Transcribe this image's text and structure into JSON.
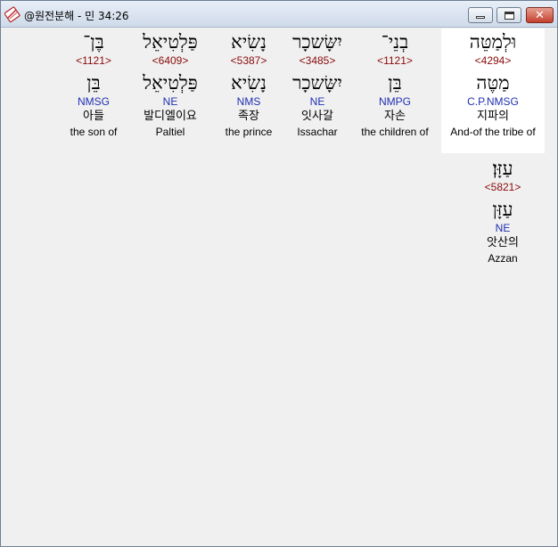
{
  "window": {
    "title": "@원전분해 - 민 34:26"
  },
  "words": [
    {
      "hebrew": "בֶּן־",
      "strong": "<1121>",
      "lemma": "בֵּן",
      "morph": "NMSG",
      "korean": "아들",
      "english": "the son of"
    },
    {
      "hebrew": "פַּלְטִיאֵל",
      "strong": "<6409>",
      "lemma": "פַּלְטִיאֵל",
      "morph": "NE",
      "korean": "발디엘이요",
      "english": "Paltiel"
    },
    {
      "hebrew": "נָשִׂיא",
      "strong": "<5387>",
      "lemma": "נָשִׂיא",
      "morph": "NMS",
      "korean": "족장",
      "english": "the prince"
    },
    {
      "hebrew": "יִשָּׂשכָר",
      "strong": "<3485>",
      "lemma": "יִשָּׂשכָר",
      "morph": "NE",
      "korean": "잇사갈",
      "english": "Issachar"
    },
    {
      "hebrew": "בְנֵי־",
      "strong": "<1121>",
      "lemma": "בֵּן",
      "morph": "NMPG",
      "korean": "자손",
      "english": "the children of"
    },
    {
      "hebrew": "וּלְמַטֵּה",
      "strong": "<4294>",
      "lemma": "מַטֶּה",
      "morph": "C.P.NMSG",
      "korean": "지파의",
      "english": "And-of the tribe of"
    },
    {
      "hebrew": "עַזָּן׃",
      "strong": "<5821>",
      "lemma": "עַזָּן",
      "morph": "NE",
      "korean": "앗산의",
      "english": "Azzan"
    }
  ]
}
